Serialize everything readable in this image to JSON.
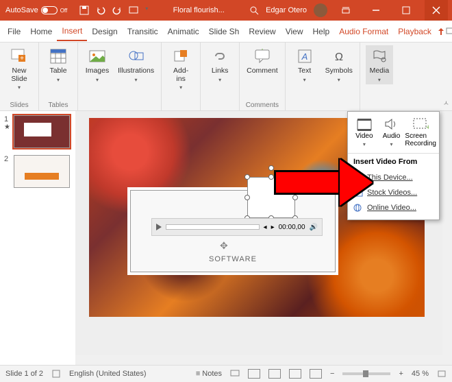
{
  "titlebar": {
    "autosave": "AutoSave",
    "autosave_state": "Off",
    "filename": "Floral flourish...",
    "username": "Edgar Otero"
  },
  "tabs": {
    "file": "File",
    "home": "Home",
    "insert": "Insert",
    "design": "Design",
    "transitions": "Transitic",
    "animations": "Animatic",
    "slideshow": "Slide Sh",
    "review": "Review",
    "view": "View",
    "help": "Help",
    "audio_format": "Audio Format",
    "playback": "Playback"
  },
  "ribbon": {
    "new_slide": "New\nSlide",
    "table": "Table",
    "images": "Images",
    "illustrations": "Illustrations",
    "addins": "Add-\nins",
    "links": "Links",
    "comment": "Comment",
    "text": "Text",
    "symbols": "Symbols",
    "media": "Media",
    "group_slides": "Slides",
    "group_tables": "Tables",
    "group_comments": "Comments"
  },
  "thumbs": {
    "n1": "1",
    "n2": "2"
  },
  "slide": {
    "software": "SOFTWARE",
    "time": "00:00,00"
  },
  "dropdown": {
    "video": "Video",
    "audio": "Audio",
    "screen": "Screen\nRecording",
    "header": "Insert Video From",
    "this_device": "This Device...",
    "stock": "Stock Videos...",
    "online": "Online Video..."
  },
  "status": {
    "slide": "Slide 1 of 2",
    "lang": "English (United States)",
    "notes": "Notes",
    "zoom": "45 %"
  }
}
